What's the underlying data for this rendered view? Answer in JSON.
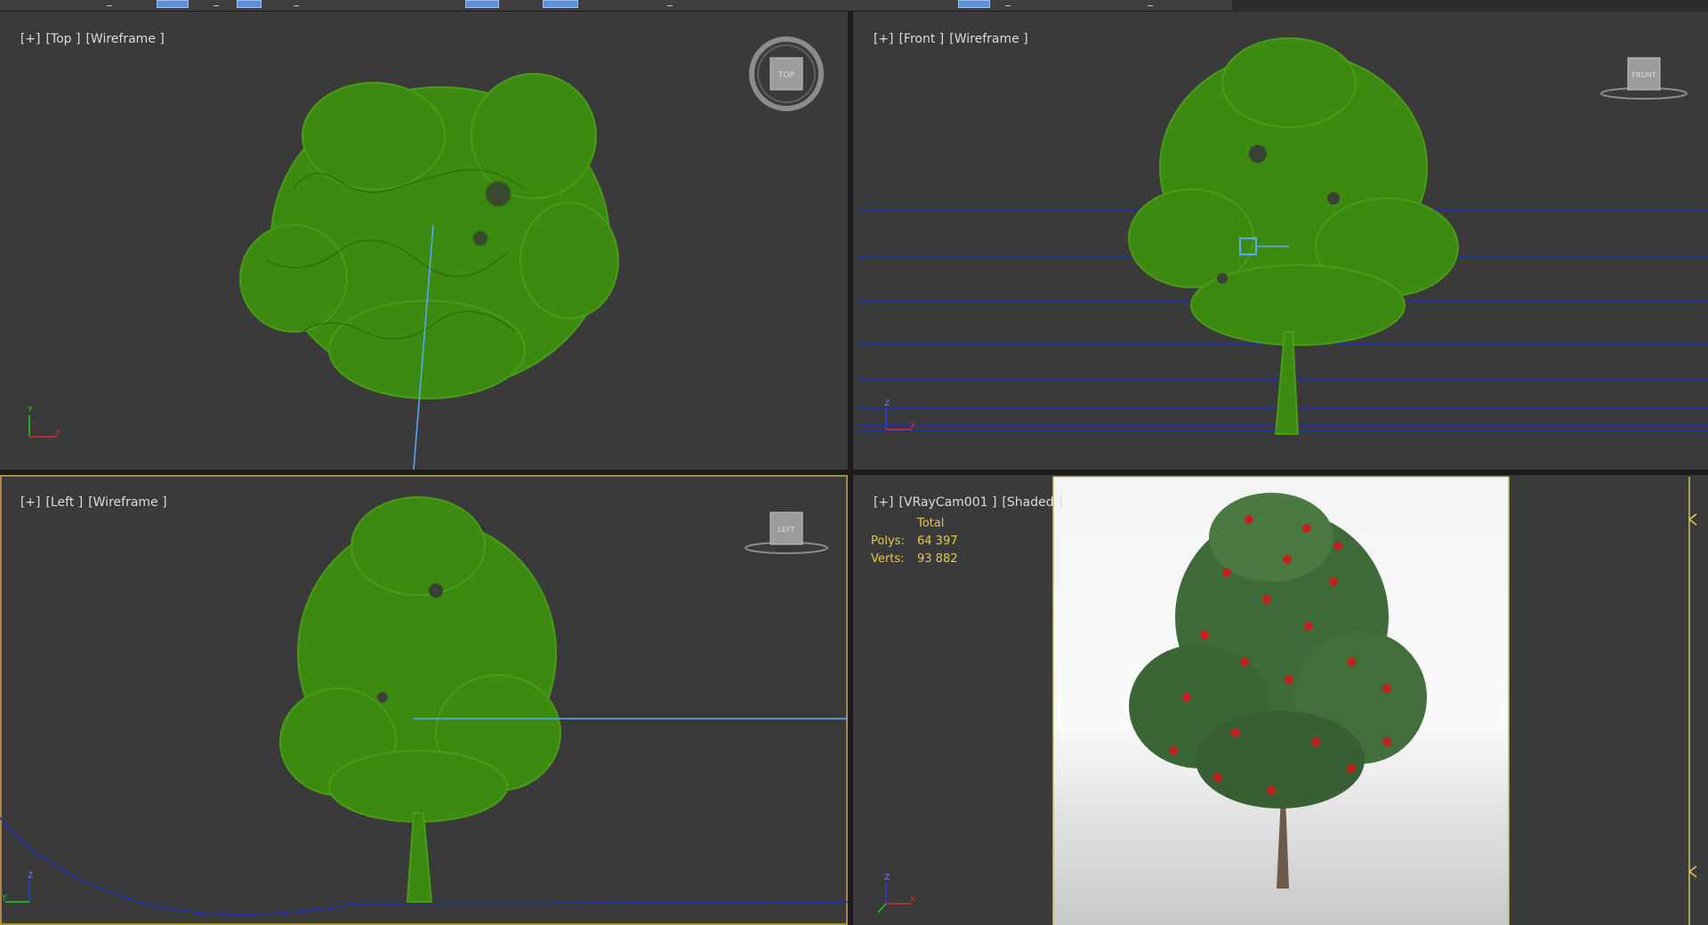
{
  "viewports": {
    "top": {
      "plus": "[+]",
      "view": "[Top ]",
      "mode": "[Wireframe ]",
      "cube_label": "TOP"
    },
    "front": {
      "plus": "[+]",
      "view": "[Front ]",
      "mode": "[Wireframe ]",
      "cube_label": "FRONT"
    },
    "left": {
      "plus": "[+]",
      "view": "[Left ]",
      "mode": "[Wireframe ]",
      "cube_label": "LEFT"
    },
    "camera": {
      "plus": "[+]",
      "view": "[VRayCam001 ]",
      "mode": "[Shaded ]",
      "stats": {
        "header": "Total",
        "polys_label": "Polys:",
        "polys_value": "64 397",
        "verts_label": "Verts:",
        "verts_value": "93 882"
      }
    }
  },
  "colors": {
    "viewport_bg": "#3a3a3a",
    "tree_wireframe": "#3c8a10",
    "stats_text": "#e5c850",
    "active_border": "#a88a3a",
    "grid_lines": "#1b2fb8",
    "selection_line": "#5aa8ff"
  },
  "icons": [
    "viewcube-icon",
    "axis-tripod-icon",
    "transform-gizmo-icon",
    "time-slider-marker-icon"
  ]
}
